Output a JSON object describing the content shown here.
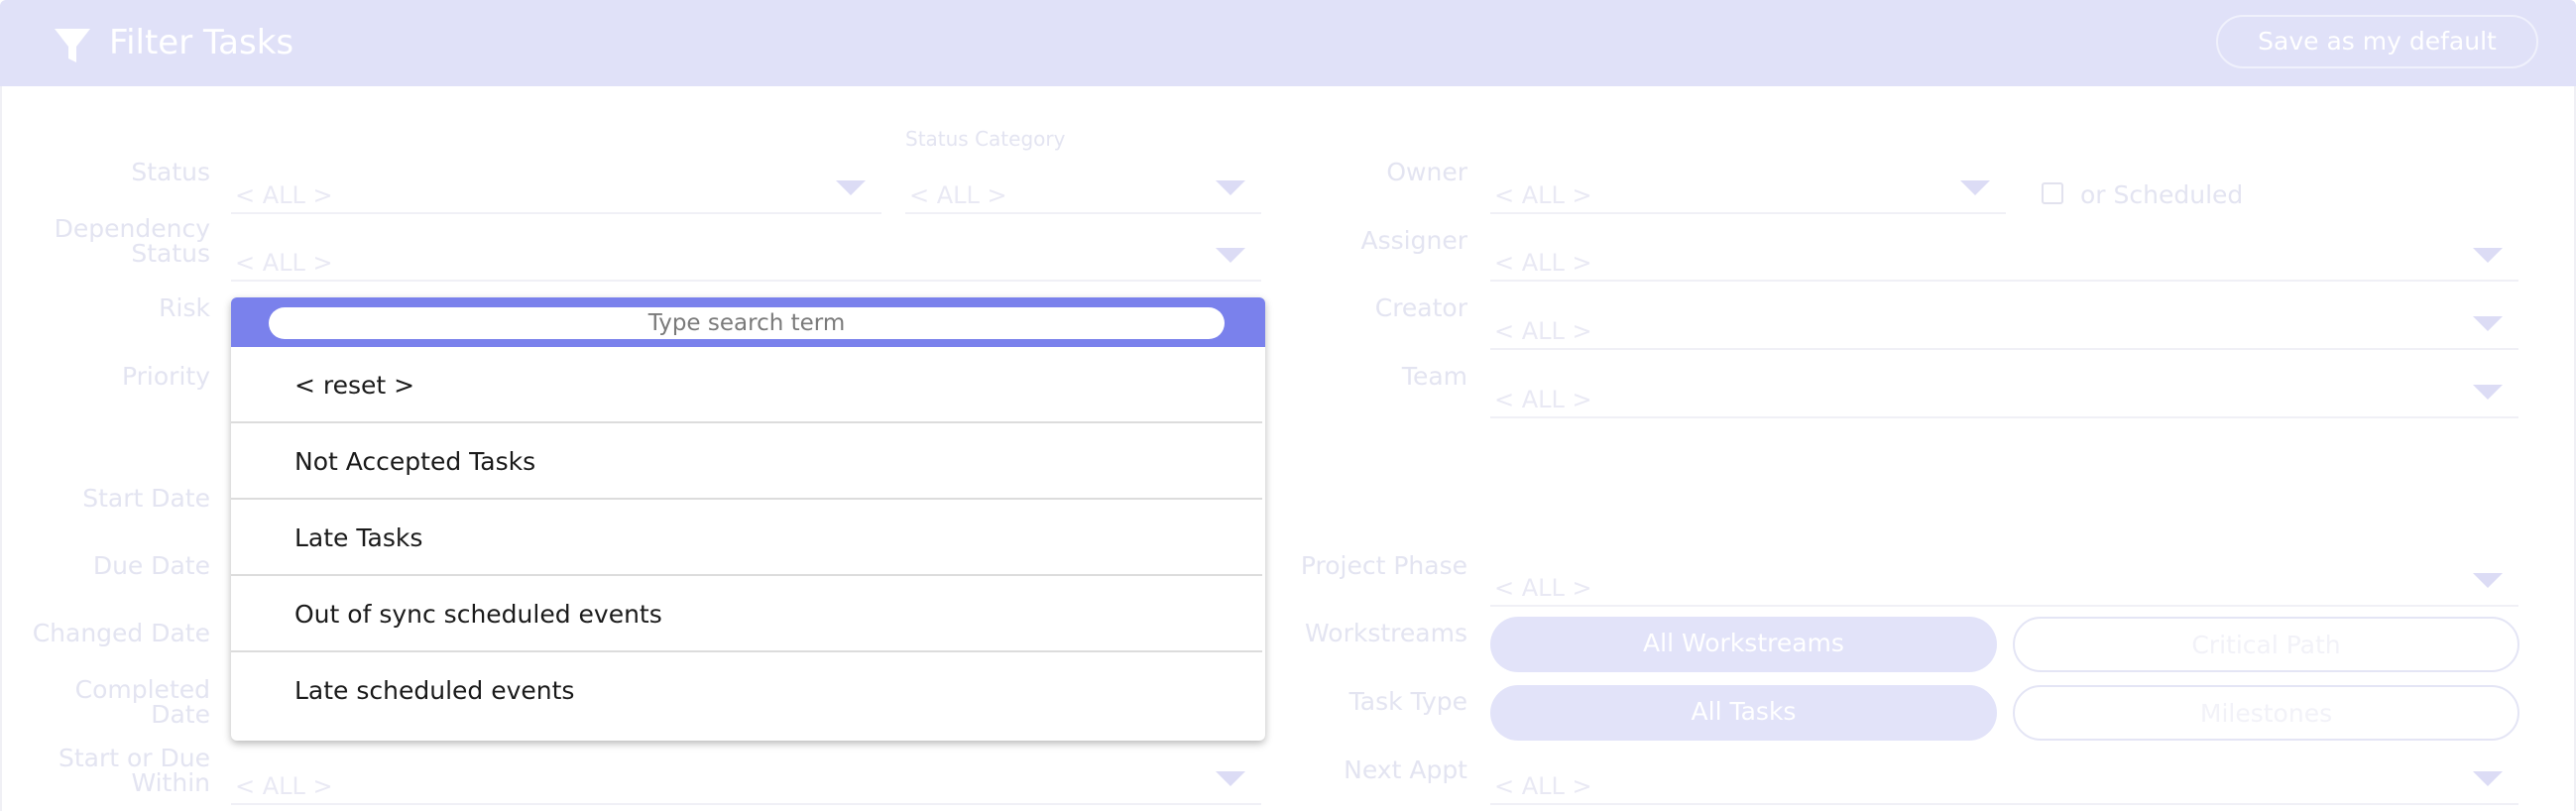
{
  "header": {
    "title": "Filter Tasks",
    "save_default_label": "Save as my default",
    "icon": "filter-icon"
  },
  "placeholder_all": "< ALL >",
  "left": {
    "status_label": "Status",
    "status_category_label": "Status Category",
    "dependency_status_label_1": "Dependency",
    "dependency_status_label_2": "Status",
    "risk_label": "Risk",
    "priority_label": "Priority",
    "start_date_label": "Start Date",
    "due_date_label": "Due Date",
    "changed_date_label": "Changed Date",
    "completed_date_label_1": "Completed",
    "completed_date_label_2": "Date",
    "start_or_due_label_1": "Start or Due",
    "start_or_due_label_2": "Within"
  },
  "right": {
    "owner_label": "Owner",
    "or_scheduled_label": "or Scheduled",
    "assigner_label": "Assigner",
    "creator_label": "Creator",
    "team_label": "Team",
    "project_phase_label": "Project Phase",
    "workstreams_label": "Workstreams",
    "workstreams_options": [
      "All Workstreams",
      "Critical Path"
    ],
    "task_type_label": "Task Type",
    "task_type_options": [
      "All Tasks",
      "Milestones"
    ],
    "next_appt_label": "Next Appt"
  },
  "dropdown": {
    "search_placeholder": "Type search term",
    "options": [
      "< reset >",
      "Not Accepted Tasks",
      "Late Tasks",
      "Out of sync scheduled events",
      "Late scheduled events"
    ]
  },
  "colors": {
    "header_bg": "#e0e1f8",
    "search_bar": "#7a81ec",
    "pill_active": "#e2e3f9"
  }
}
